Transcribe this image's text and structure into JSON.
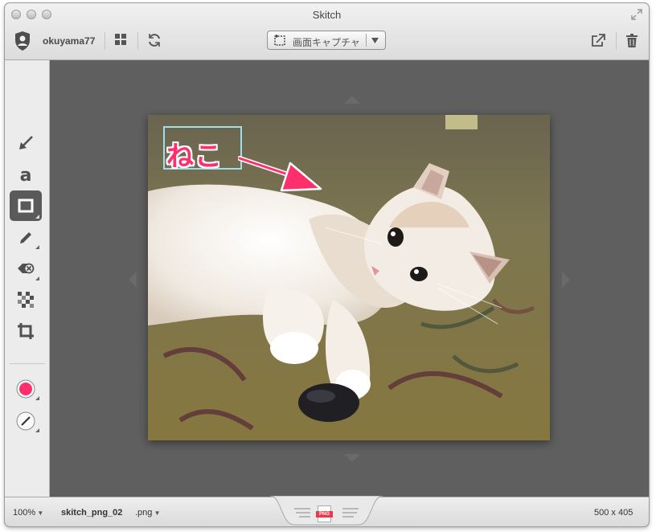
{
  "window": {
    "title": "Skitch"
  },
  "toolbar": {
    "username": "okuyama77",
    "capture_label": "画面キャプチャ",
    "icons": [
      "account-icon",
      "grid-icon",
      "sync-icon",
      "capture-icon",
      "dropdown-arrow-icon",
      "share-icon",
      "trash-icon"
    ]
  },
  "tools": [
    "arrow",
    "text",
    "rectangle",
    "pen",
    "highlighter-eraser",
    "pixelate",
    "crop",
    "color",
    "line-width"
  ],
  "colors": {
    "accent": "#ff2f6d",
    "annotation_border": "#9ee0ea",
    "canvas_bg": "#5f5f5f"
  },
  "annotation": {
    "text": "ねこ"
  },
  "statusbar": {
    "zoom": "100%",
    "filename": "skitch_png_02",
    "extension": ".png",
    "dimensions": "500 x 405",
    "file_badge": "PNG"
  }
}
